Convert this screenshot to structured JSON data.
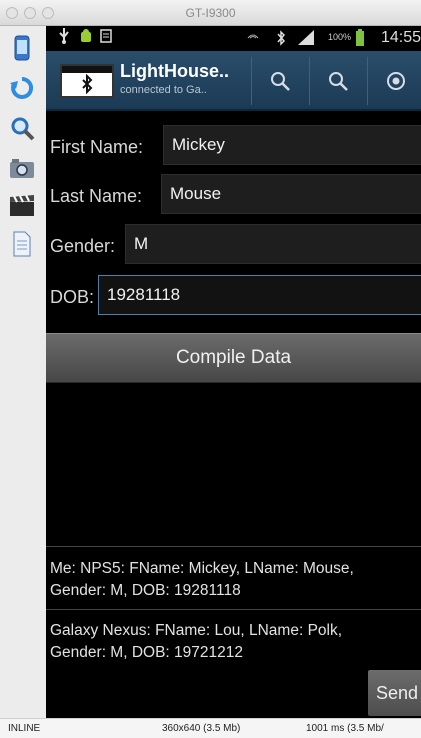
{
  "window": {
    "title": "GT-I9300"
  },
  "statusbar": {
    "battery_pct": "100%",
    "time": "14:55"
  },
  "actionbar": {
    "app_name": "LightHouse..",
    "subtitle": "connected to Ga..",
    "icon_label": "LIGHTHOUSE"
  },
  "form": {
    "first_name_label": "First Name:",
    "first_name_value": "Mickey",
    "last_name_label": "Last Name:",
    "last_name_value": "Mouse",
    "gender_label": "Gender:",
    "gender_value": "M",
    "dob_label": "DOB:",
    "dob_value": "19281118"
  },
  "compile_button": "Compile Data",
  "messages": [
    {
      "line1": "Me: NPS5: FName: Mickey, LName: Mouse,",
      "line2": "Gender: M, DOB: 19281118"
    },
    {
      "line1": "Galaxy Nexus:  FName: Lou, LName: Polk,",
      "line2": "Gender: M, DOB: 19721212"
    }
  ],
  "send_button": "Send",
  "bottombar": {
    "mode": "INLINE",
    "resolution": "360x640 (3.5 Mb)",
    "timing": "1001 ms (3.5 Mb/"
  }
}
